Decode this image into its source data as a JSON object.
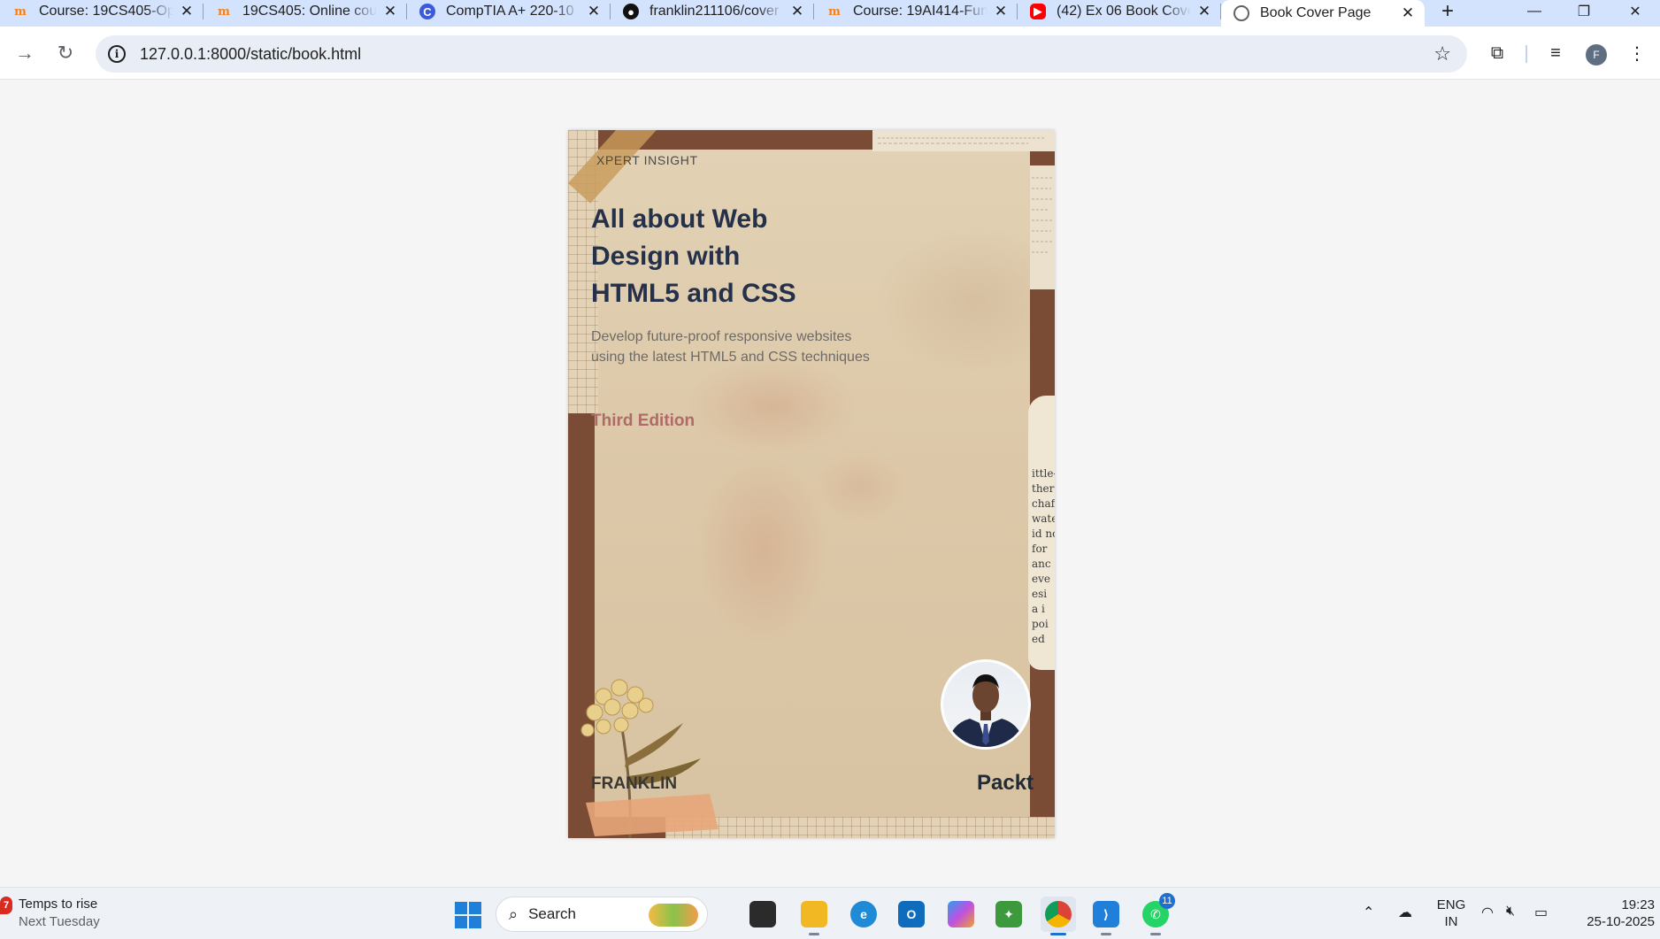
{
  "browser": {
    "tabs": [
      {
        "title": "Course: 19CS405-Op",
        "icon": "moodle-icon"
      },
      {
        "title": "19CS405: Online cou",
        "icon": "moodle-icon"
      },
      {
        "title": "CompTIA A+ 220-10",
        "icon": "comptia-icon"
      },
      {
        "title": "franklin211106/cover",
        "icon": "github-icon"
      },
      {
        "title": "Course: 19AI414-Fun",
        "icon": "moodle-icon"
      },
      {
        "title": "(42) Ex 06 Book Cove",
        "icon": "youtube-icon"
      },
      {
        "title": "Book Cover Page",
        "icon": "globe-icon",
        "active": true
      }
    ],
    "new_tab_symbol": "+",
    "address": "127.0.0.1:8000/static/book.html",
    "profile_initial": "F"
  },
  "cover": {
    "series": "XPERT INSIGHT",
    "title_lines": [
      "All about Web",
      "Design with",
      "HTML5 and CSS"
    ],
    "subtitle_lines": [
      "Develop future-proof responsive websites",
      "using the latest HTML5 and CSS techniques"
    ],
    "edition": "Third Edition",
    "author": "FRANKLIN",
    "publisher": "Packt",
    "newsprint_right": [
      "ittle-t",
      "there",
      "chaffi",
      "wate",
      "id no",
      "for",
      "anc",
      "eve",
      "esi",
      "a i",
      "poi",
      "ed"
    ],
    "colors": {
      "frame": "#7a4c35",
      "paper": "#dcc8a8",
      "title": "#25314a",
      "edition": "#b06a6a"
    }
  },
  "taskbar": {
    "weather_badge": "7",
    "weather_title": "Temps to rise",
    "weather_subtitle": "Next Tuesday",
    "search_label": "Search",
    "whatsapp_badge": "11",
    "language_line1": "ENG",
    "language_line2": "IN",
    "time": "19:23",
    "date": "25-10-2025"
  }
}
